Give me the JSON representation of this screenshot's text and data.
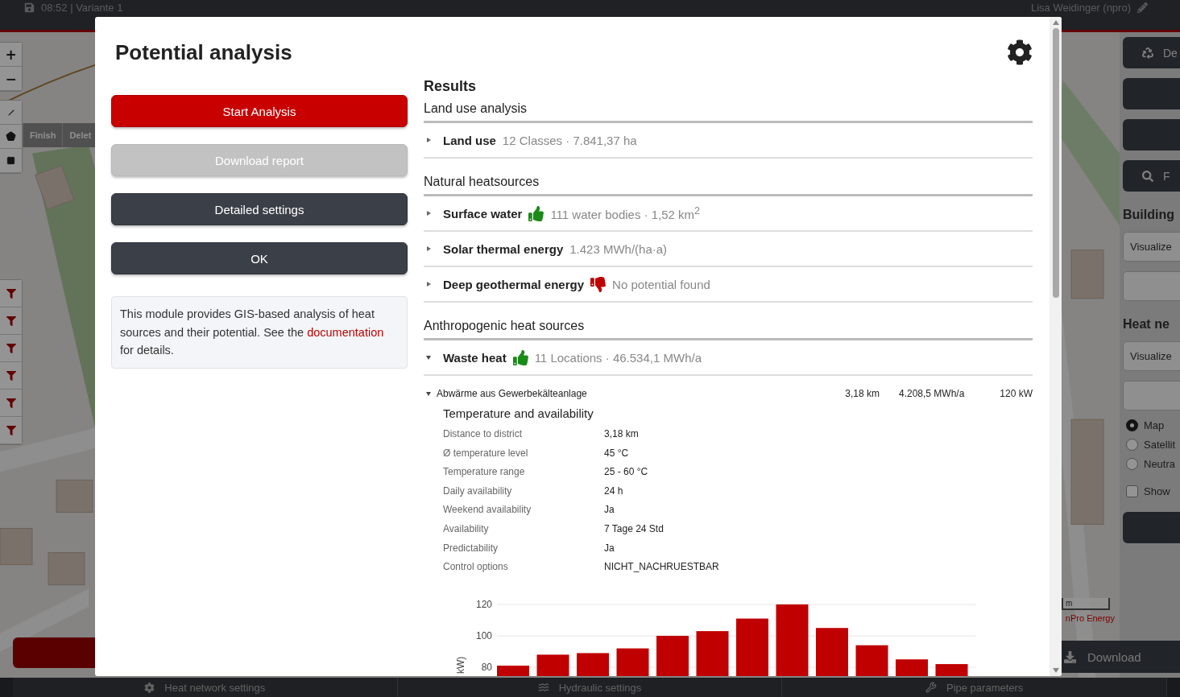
{
  "top_bar": {
    "status": "08:52  |  Variante 1",
    "user": "Lisa Weidinger (npro)"
  },
  "map": {
    "zoom_buttons": [
      "+",
      "−"
    ],
    "draw_actions": [
      "Finish",
      "Delet"
    ],
    "scale_label": "m",
    "attribution": "nPro Energy"
  },
  "side_panel": {
    "items": [
      {
        "kind": "recycle_button",
        "label": "De"
      },
      {
        "kind": "button"
      },
      {
        "kind": "button"
      },
      {
        "kind": "search_button",
        "label": "F"
      },
      {
        "kind": "heading",
        "label": "Building"
      },
      {
        "kind": "field",
        "value": "Visualize"
      },
      {
        "kind": "field"
      },
      {
        "kind": "heading",
        "label": "Heat ne"
      },
      {
        "kind": "field",
        "value": "Visualize"
      },
      {
        "kind": "field"
      }
    ],
    "radios": [
      {
        "label": "Map",
        "selected": true
      },
      {
        "label": "Satellit",
        "selected": false
      },
      {
        "label": "Neutra",
        "selected": false
      }
    ],
    "checkbox": {
      "label": "Show",
      "checked": false
    },
    "download": "Download"
  },
  "bottom_tabs": [
    "Heat network settings",
    "Hydraulic settings",
    "Pipe parameters"
  ],
  "dialog": {
    "title": "Potential analysis",
    "buttons": [
      {
        "label": "Start Analysis",
        "disabled": false
      },
      {
        "label": "Download report",
        "disabled": true
      },
      {
        "label": "Detailed settings",
        "disabled": false
      },
      {
        "label": "OK",
        "disabled": false
      }
    ],
    "info": {
      "before": "This module provides GIS-based analysis of heat sources and their potential. See the ",
      "link": "documentation",
      "after": " for details."
    },
    "results": {
      "title": "Results",
      "sections": [
        {
          "title": "Land use analysis",
          "items": [
            {
              "label": "Land use",
              "summary": "12 Classes · 7.841,37 ha",
              "expanded": false
            }
          ]
        },
        {
          "title": "Natural heatsources",
          "items": [
            {
              "label": "Surface water",
              "potential": true,
              "summary": "111 water bodies · 1,52 km$^{2}$",
              "expanded": false
            },
            {
              "label": "Solar thermal energy",
              "summary": "1.423 MWh/(ha·a)",
              "expanded": false
            },
            {
              "label": "Deep geothermal energy",
              "potential": false,
              "summary": "No potential found",
              "expanded": false
            }
          ]
        },
        {
          "title": "Anthropogenic heat sources",
          "items": [
            {
              "label": "Waste heat",
              "potential": true,
              "summary": "11 Locations · 46.534,1 MWh/a",
              "expanded": true,
              "locations": [
                {
                  "name": "Abwärme aus Gewerbekälteanlage",
                  "distance": "3,18 km",
                  "energy": "4.208,5 MWh/a",
                  "power": "120 kW",
                  "expanded": true,
                  "detail_title": "Temperature and availability",
                  "details": [
                    {
                      "label": "Distance to district",
                      "value": "3,18 km"
                    },
                    {
                      "label": "Ø temperature level",
                      "value": "45 °C"
                    },
                    {
                      "label": "Temperature range",
                      "value": "25 - 60 °C"
                    },
                    {
                      "label": "Daily availability",
                      "value": "24 h"
                    },
                    {
                      "label": "Weekend availability",
                      "value": "Ja"
                    },
                    {
                      "label": "Availability",
                      "value": "7 Tage 24 Std"
                    },
                    {
                      "label": "Predictability",
                      "value": "Ja"
                    },
                    {
                      "label": "Control options",
                      "value": "NICHT_NACHRUESTBAR"
                    }
                  ],
                  "chart_data": {
                    "type": "bar",
                    "ylabel": "kW)",
                    "ylim": [
                      0,
                      120
                    ],
                    "grid": true,
                    "yticks": [
                      80,
                      100,
                      120
                    ],
                    "series": [
                      {
                        "color": "#c00000",
                        "values": [
                          81,
                          88,
                          89,
                          92,
                          100,
                          103,
                          111,
                          120,
                          105,
                          94,
                          85,
                          82
                        ]
                      }
                    ]
                  }
                }
              ]
            }
          ]
        }
      ]
    }
  }
}
